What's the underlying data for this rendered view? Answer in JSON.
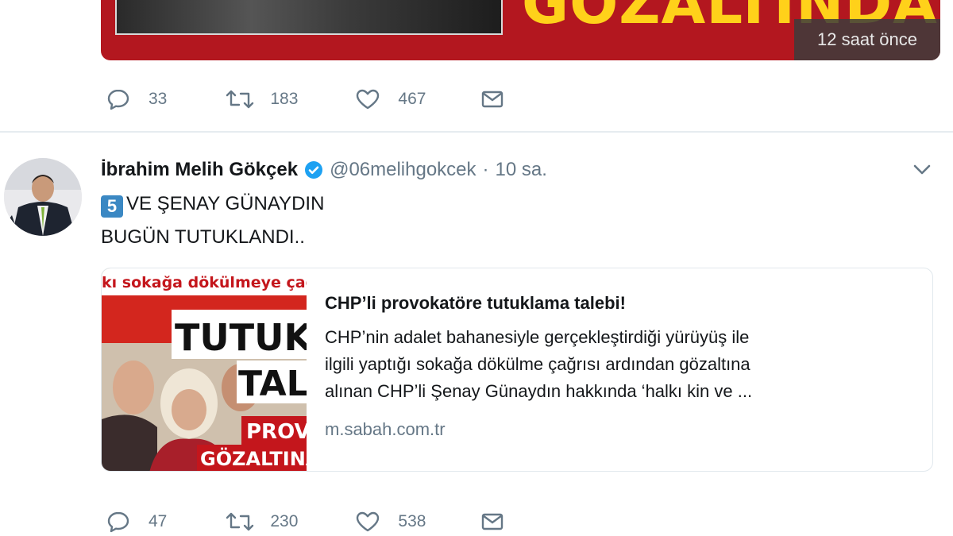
{
  "top_tweet": {
    "media": {
      "headline": "GÖZALTINDA!",
      "timestamp": "12 saat önce"
    },
    "actions": {
      "replies": "33",
      "retweets": "183",
      "likes": "467"
    }
  },
  "tweet": {
    "author_name": "İbrahim Melih Gökçek",
    "handle": "@06melihgokcek",
    "separator": "·",
    "time": "10 sa.",
    "keycap": "5",
    "text_line1": "VE ŞENAY GÜNAYDIN",
    "text_line2": "BUGÜN TUTUKLANDI..",
    "card": {
      "image_texts": {
        "banner": "kı sokağa dökülmeye çağır",
        "big1": "TUTUKL",
        "big2": "TALE",
        "sub1": "PROV",
        "sub2": "GÖZALTINA"
      },
      "title": "CHP’li provokatöre tutuklama talebi!",
      "description_lines": [
        "CHP’nin adalet bahanesiyle gerçekleştirdiği yürüyüş ile",
        "ilgili yaptığı sokağa dökülme çağrısı ardından gözaltına",
        "alınan CHP’li Şenay Günaydın hakkında ‘halkı kin ve ..."
      ],
      "url": "m.sabah.com.tr"
    },
    "actions": {
      "replies": "47",
      "retweets": "230",
      "likes": "538"
    }
  },
  "icons": {
    "reply": "reply-icon",
    "retweet": "retweet-icon",
    "like": "heart-icon",
    "message": "envelope-icon",
    "verified": "verified-badge-icon",
    "menu": "chevron-down-icon"
  },
  "colors": {
    "accent": "#1da1f2",
    "muted": "#657786",
    "media_red": "#b3171f",
    "media_yellow": "#ffd11a",
    "keycap_blue": "#3b88c3"
  }
}
